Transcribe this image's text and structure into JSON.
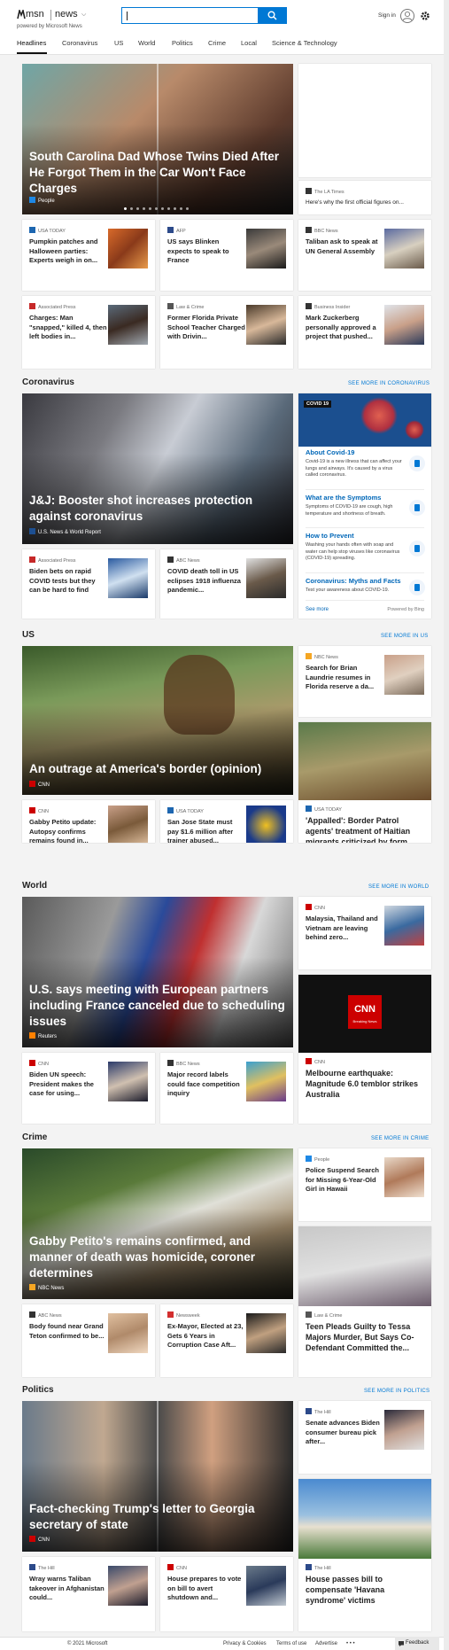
{
  "header": {
    "brand_msn": "msn",
    "brand_news": "news",
    "powered": "powered by Microsoft News",
    "search_value": "",
    "signin": "Sign in"
  },
  "nav": [
    "Headlines",
    "Coronavirus",
    "US",
    "World",
    "Politics",
    "Crime",
    "Local",
    "Science & Technology"
  ],
  "headlines": {
    "hero": {
      "title": "South Carolina Dad Whose Twins Died After He Forgot Them in the Car Won't Face Charges",
      "source": "People"
    },
    "side_top": {
      "source": "The LA Times",
      "title": "Here's why the first official figures on..."
    },
    "cards": [
      {
        "source": "USA TODAY",
        "title": "Pumpkin patches and Halloween parties: Experts weigh in on..."
      },
      {
        "source": "AFP",
        "title": "US says Blinken expects to speak to France"
      },
      {
        "source": "BBC News",
        "title": "Taliban ask to speak at UN General Assembly"
      },
      {
        "source": "Associated Press",
        "title": "Charges: Man \"snapped,\" killed 4, then left bodies in..."
      },
      {
        "source": "Law & Crime",
        "title": "Former Florida Private School Teacher Charged with Drivin..."
      },
      {
        "source": "Business Insider",
        "title": "Mark Zuckerberg personally approved a project that pushed..."
      }
    ]
  },
  "coronavirus": {
    "title": "Coronavirus",
    "see_more": "SEE MORE IN CORONAVIRUS",
    "hero": {
      "title": "J&J: Booster shot increases protection against coronavirus",
      "source": "U.S. News & World Report"
    },
    "cards": [
      {
        "source": "Associated Press",
        "title": "Biden bets on rapid COVID tests but they can be hard to find"
      },
      {
        "source": "ABC News",
        "title": "COVID death toll in US eclipses 1918 influenza pandemic..."
      }
    ],
    "panel": {
      "badge": "COVID 19",
      "items": [
        {
          "title": "About Covid-19",
          "desc": "Covid-19 is a new illness that can affect your lungs and airways. It's caused by a virus called coronavirus."
        },
        {
          "title": "What are the Symptoms",
          "desc": "Symptoms of COVID-19 are cough, high temperature and shortness of breath."
        },
        {
          "title": "How to Prevent",
          "desc": "Washing your hands often with soap and water can help stop viruses like coronavirus (COVID-19) spreading."
        },
        {
          "title": "Coronavirus: Myths and Facts",
          "desc": "Test your awareness about COVID-19."
        }
      ],
      "see_more": "See more",
      "powered": "Powered by Bing"
    }
  },
  "us": {
    "title": "US",
    "see_more": "SEE MORE IN US",
    "hero": {
      "title": "An outrage at America's border (opinion)",
      "source": "CNN"
    },
    "side_top": {
      "source": "NBC News",
      "title": "Search for Brian Laundrie resumes in Florida reserve a da..."
    },
    "side_big": {
      "source": "USA TODAY",
      "title": "'Appalled': Border Patrol agents' treatment of Haitian migrants criticized by form..."
    },
    "cards": [
      {
        "source": "CNN",
        "title": "Gabby Petito update: Autopsy confirms remains found in..."
      },
      {
        "source": "USA TODAY",
        "title": "San Jose State must pay $1.6 million after trainer abused..."
      }
    ]
  },
  "world": {
    "title": "World",
    "see_more": "SEE MORE IN WORLD",
    "hero": {
      "title": "U.S. says meeting with European partners including France canceled due to scheduling issues",
      "source": "Reuters"
    },
    "side_top": {
      "source": "CNN",
      "title": "Malaysia, Thailand and Vietnam are leaving behind zero..."
    },
    "side_big": {
      "source": "CNN",
      "title": "Melbourne earthquake: Magnitude 6.0 temblor strikes Australia",
      "logo_text": "CNN",
      "logo_sub": "Breaking News"
    },
    "cards": [
      {
        "source": "CNN",
        "title": "Biden UN speech: President makes the case for using..."
      },
      {
        "source": "BBC News",
        "title": "Major record labels could face competition inquiry"
      }
    ]
  },
  "crime": {
    "title": "Crime",
    "see_more": "SEE MORE IN CRIME",
    "hero": {
      "title": "Gabby Petito's remains confirmed, and manner of death was homicide, coroner determines",
      "source": "NBC News"
    },
    "side_top": {
      "source": "People",
      "title": "Police Suspend Search for Missing 6-Year-Old Girl in Hawaii"
    },
    "side_big": {
      "source": "Law & Crime",
      "title": "Teen Pleads Guilty to Tessa Majors Murder, But Says Co-Defendant Committed the..."
    },
    "cards": [
      {
        "source": "ABC News",
        "title": "Body found near Grand Teton confirmed to be..."
      },
      {
        "source": "Newsweek",
        "title": "Ex-Mayor, Elected at 23, Gets 6 Years in Corruption Case Aft..."
      }
    ]
  },
  "politics": {
    "title": "Politics",
    "see_more": "SEE MORE IN POLITICS",
    "hero": {
      "title": "Fact-checking Trump's letter to Georgia secretary of state",
      "source": "CNN"
    },
    "side_top": {
      "source": "The Hill",
      "title": "Senate advances Biden consumer bureau pick after..."
    },
    "side_big": {
      "source": "The Hill",
      "title": "House passes bill to compensate 'Havana syndrome' victims"
    },
    "cards": [
      {
        "source": "The Hill",
        "title": "Wray warns Taliban takeover in Afghanistan could..."
      },
      {
        "source": "CNN",
        "title": "House prepares to vote on bill to avert shutdown and..."
      }
    ]
  },
  "footer": {
    "copyright": "© 2021 Microsoft",
    "privacy": "Privacy & Cookies",
    "terms": "Terms of use",
    "advertise": "Advertise",
    "more": "• • •",
    "feedback": "Feedback"
  },
  "colors": {
    "accent": "#0078d4",
    "background": "#f3f3f3"
  }
}
